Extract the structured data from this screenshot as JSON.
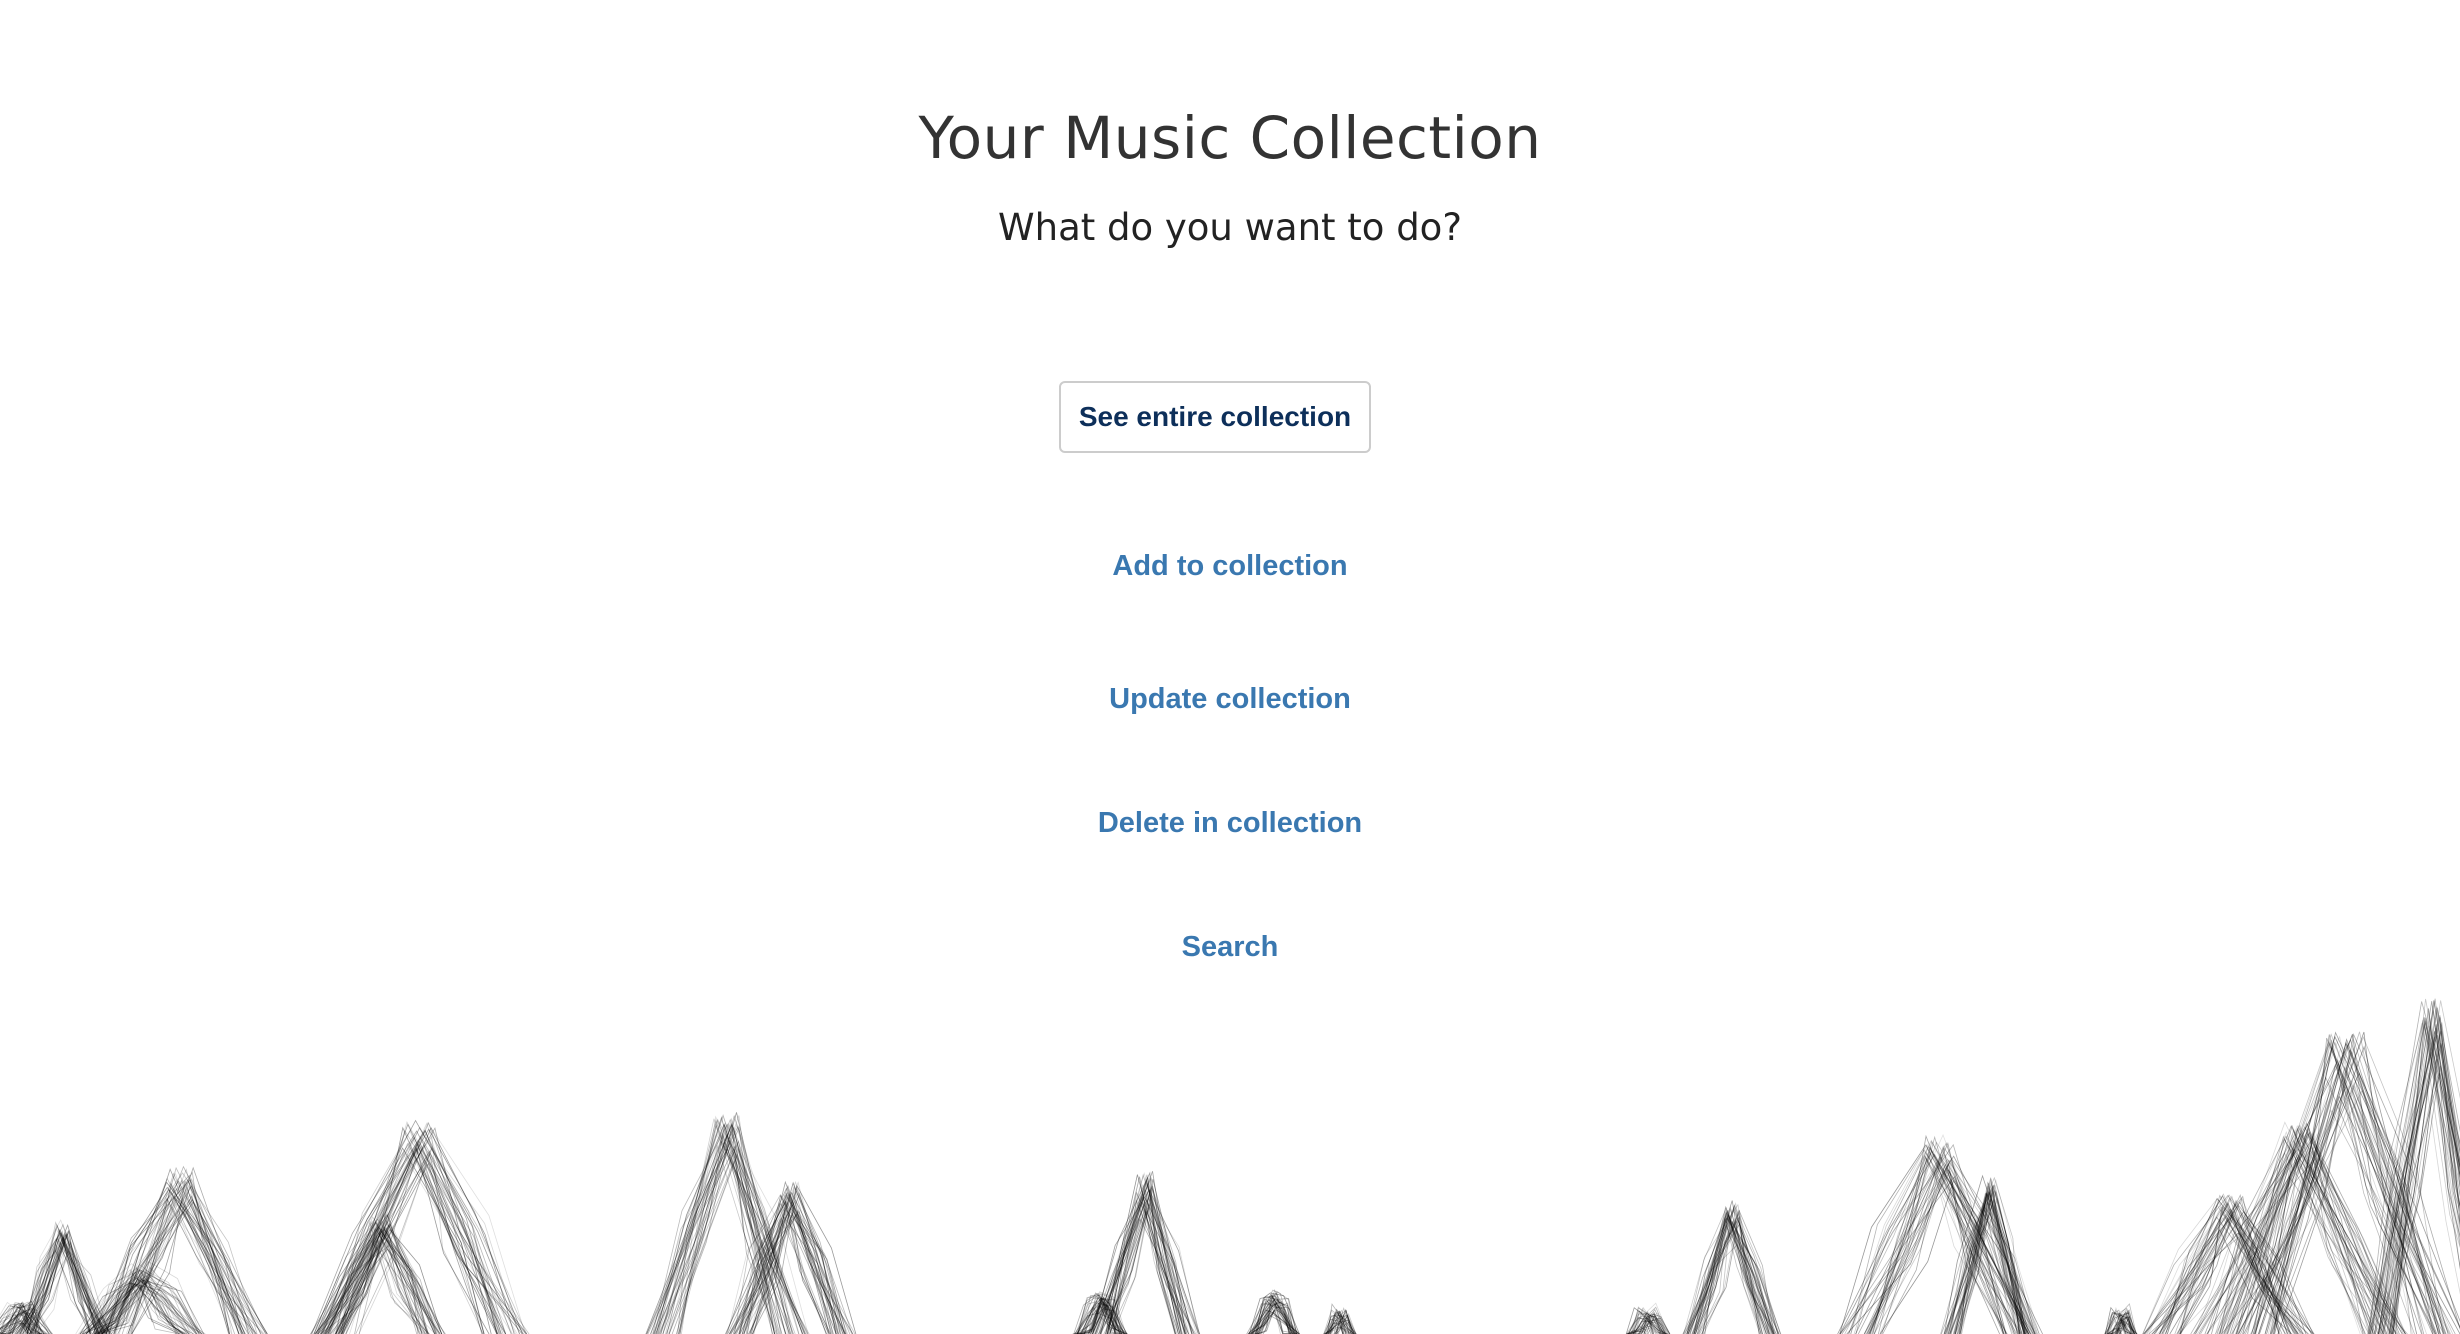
{
  "header": {
    "title": "Your Music Collection",
    "subtitle": "What do you want to do?"
  },
  "actions": {
    "primary_label": "See entire collection",
    "links": [
      {
        "label": "Add to collection"
      },
      {
        "label": "Update collection"
      },
      {
        "label": "Delete in collection"
      },
      {
        "label": "Search"
      }
    ]
  },
  "colors": {
    "link": "#3a78b0",
    "primary_text": "#0d2f5a",
    "mountain_stroke": "#000000"
  }
}
